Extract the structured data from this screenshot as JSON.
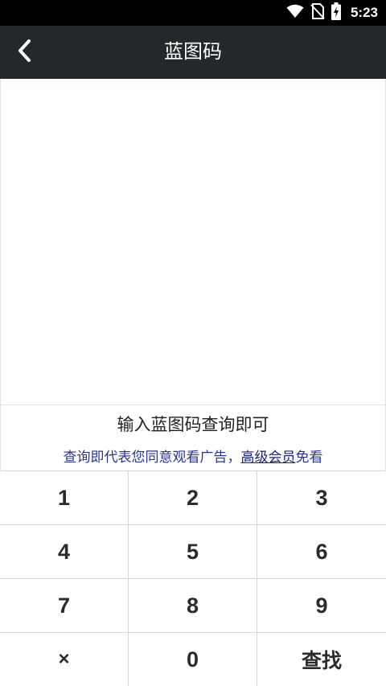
{
  "status_bar": {
    "time": "5:23",
    "icons": [
      "wifi-icon",
      "no-sim-icon",
      "battery-charging-icon"
    ]
  },
  "app_bar": {
    "back_icon": "chevron-left-icon",
    "title": "蓝图码"
  },
  "input_area": {
    "hint": "输入蓝图码查询即可",
    "notice_prefix": "查询即代表您同意观看广告，",
    "notice_link": "高级会员",
    "notice_suffix": "免看"
  },
  "keypad": {
    "keys": [
      "1",
      "2",
      "3",
      "4",
      "5",
      "6",
      "7",
      "8",
      "9",
      "×",
      "0",
      "查找"
    ]
  },
  "colors": {
    "status_bar_bg": "#000000",
    "app_bar_bg": "#23292a",
    "notice_text": "#283593",
    "key_text": "#2b2b2b"
  }
}
